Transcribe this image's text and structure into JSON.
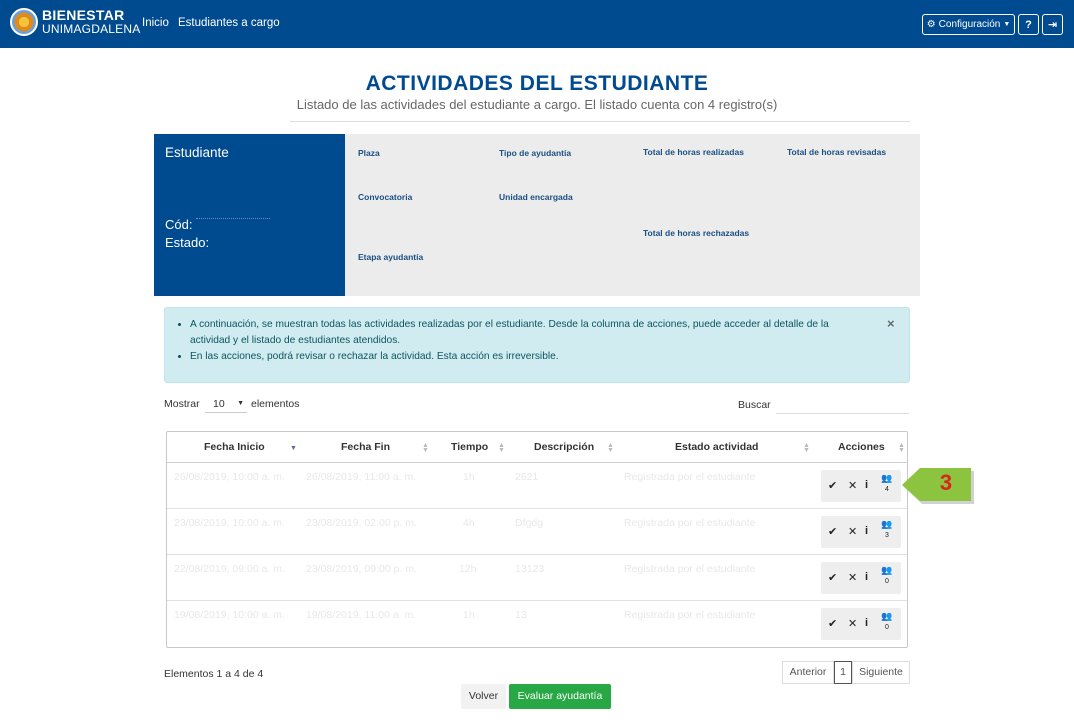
{
  "nav": {
    "brand_line1": "BIENESTAR",
    "brand_line2": "UNIMAGDALENA",
    "links": [
      "Inicio",
      "Estudiantes a cargo"
    ],
    "config_label": "Configuración",
    "help_icon": "question-icon",
    "exit_icon": "sign-out-icon"
  },
  "page": {
    "title": "ACTIVIDADES DEL ESTUDIANTE",
    "subtitle": "Listado de las actividades del estudiante a cargo. El listado cuenta con 4 registro(s)"
  },
  "student": {
    "header": "Estudiante",
    "cod_label": "Cód:",
    "estado_label": "Estado:",
    "fields": {
      "plaza": "Plaza",
      "tipo": "Tipo de ayudantía",
      "horas_realizadas": "Total de horas realizadas",
      "horas_revisadas": "Total de horas revisadas",
      "convocatoria": "Convocatoria",
      "unidad": "Unidad encargada",
      "horas_rechazadas": "Total de horas rechazadas",
      "etapa": "Etapa ayudantía"
    }
  },
  "alert": {
    "items": [
      "A continuación, se muestran todas las actividades realizadas por el estudiante. Desde la columna de acciones, puede acceder al detalle de la actividad y el listado de estudiantes atendidos.",
      "En las acciones, podrá revisar o rechazar la actividad. Esta acción es irreversible."
    ],
    "close": "×"
  },
  "controls": {
    "show_label": "Mostrar",
    "page_length": "10",
    "elements_label": "elementos",
    "search_label": "Buscar"
  },
  "table": {
    "headers": [
      "Fecha Inicio",
      "Fecha Fin",
      "Tiempo",
      "Descripción",
      "Estado actividad",
      "Acciones"
    ],
    "rows": [
      {
        "inicio": "26/08/2019, 10:00 a. m.",
        "fin": "26/08/2019, 11:00 a. m.",
        "tiempo": "1h",
        "descripcion": "2621",
        "estado": "Registrada por el estudiante",
        "count": "4"
      },
      {
        "inicio": "23/08/2019, 10:00 a. m.",
        "fin": "23/08/2019, 02:00 p. m.",
        "tiempo": "4h",
        "descripcion": "Dfgdg",
        "estado": "Registrada por el estudiante",
        "count": "3"
      },
      {
        "inicio": "22/08/2019, 09:00 a. m.",
        "fin": "23/08/2019, 09:00 p. m.",
        "tiempo": "12h",
        "descripcion": "13123",
        "estado": "Registrada por el estudiante",
        "count": "0"
      },
      {
        "inicio": "19/08/2019, 10:00 a. m.",
        "fin": "19/08/2019, 11:00 a. m.",
        "tiempo": "1h",
        "descripcion": "13",
        "estado": "Registrada por el estudiante",
        "count": "0"
      }
    ]
  },
  "footer": {
    "info": "Elementos 1 a 4 de 4",
    "prev": "Anterior",
    "page": "1",
    "next": "Siguiente",
    "back": "Volver",
    "evaluate": "Evaluar ayudantía"
  },
  "callout": {
    "number": "3",
    "color": "#8cc43f"
  },
  "colors": {
    "primary": "#004a8f",
    "success": "#28a745",
    "alert_bg": "#d1ecf1"
  }
}
